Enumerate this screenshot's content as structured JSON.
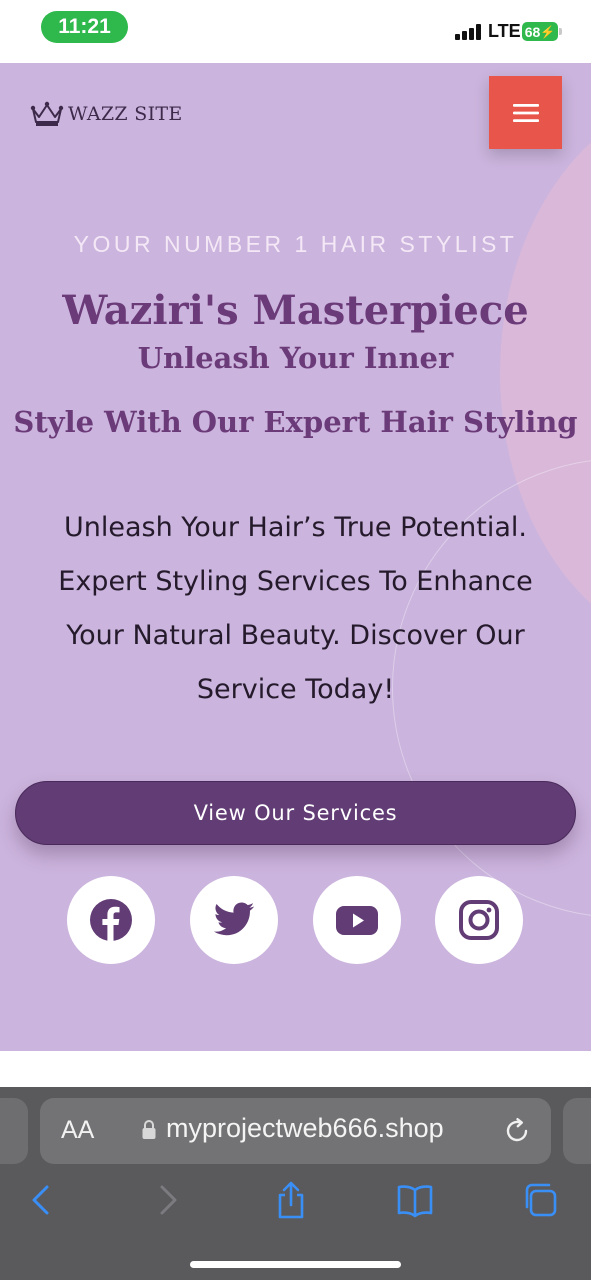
{
  "status_bar": {
    "time": "11:21",
    "network": "LTE",
    "battery": "68"
  },
  "header": {
    "logo_text": "WAZZ SITE",
    "logo_icon": "crown-icon",
    "menu_icon": "hamburger-icon"
  },
  "hero": {
    "tagline": "YOUR NUMBER 1 HAIR STYLIST",
    "title": "Waziri's Masterpiece",
    "subtitle_line1": "Unleash Your Inner",
    "subtitle_line2": "Style With Our Expert Hair Styling",
    "body": "Unleash Your Hair’s True Potential. Expert Styling Services To Enhance Your Natural Beauty. Discover Our Service Today!",
    "cta_label": "View Our Services"
  },
  "social": [
    "facebook-icon",
    "twitter-icon",
    "youtube-icon",
    "instagram-icon"
  ],
  "browser": {
    "aa_label": "AA",
    "url": "myprojectweb666.shop",
    "toolbar": [
      "back-icon",
      "forward-icon",
      "share-icon",
      "bookmarks-icon",
      "tabs-icon"
    ]
  },
  "colors": {
    "hero_bg": "#cbb4dd",
    "accent_purple": "#623c75",
    "title_purple": "#6b3a78",
    "menu_red": "#e8554a",
    "safari_blue": "#3a8ff7"
  }
}
